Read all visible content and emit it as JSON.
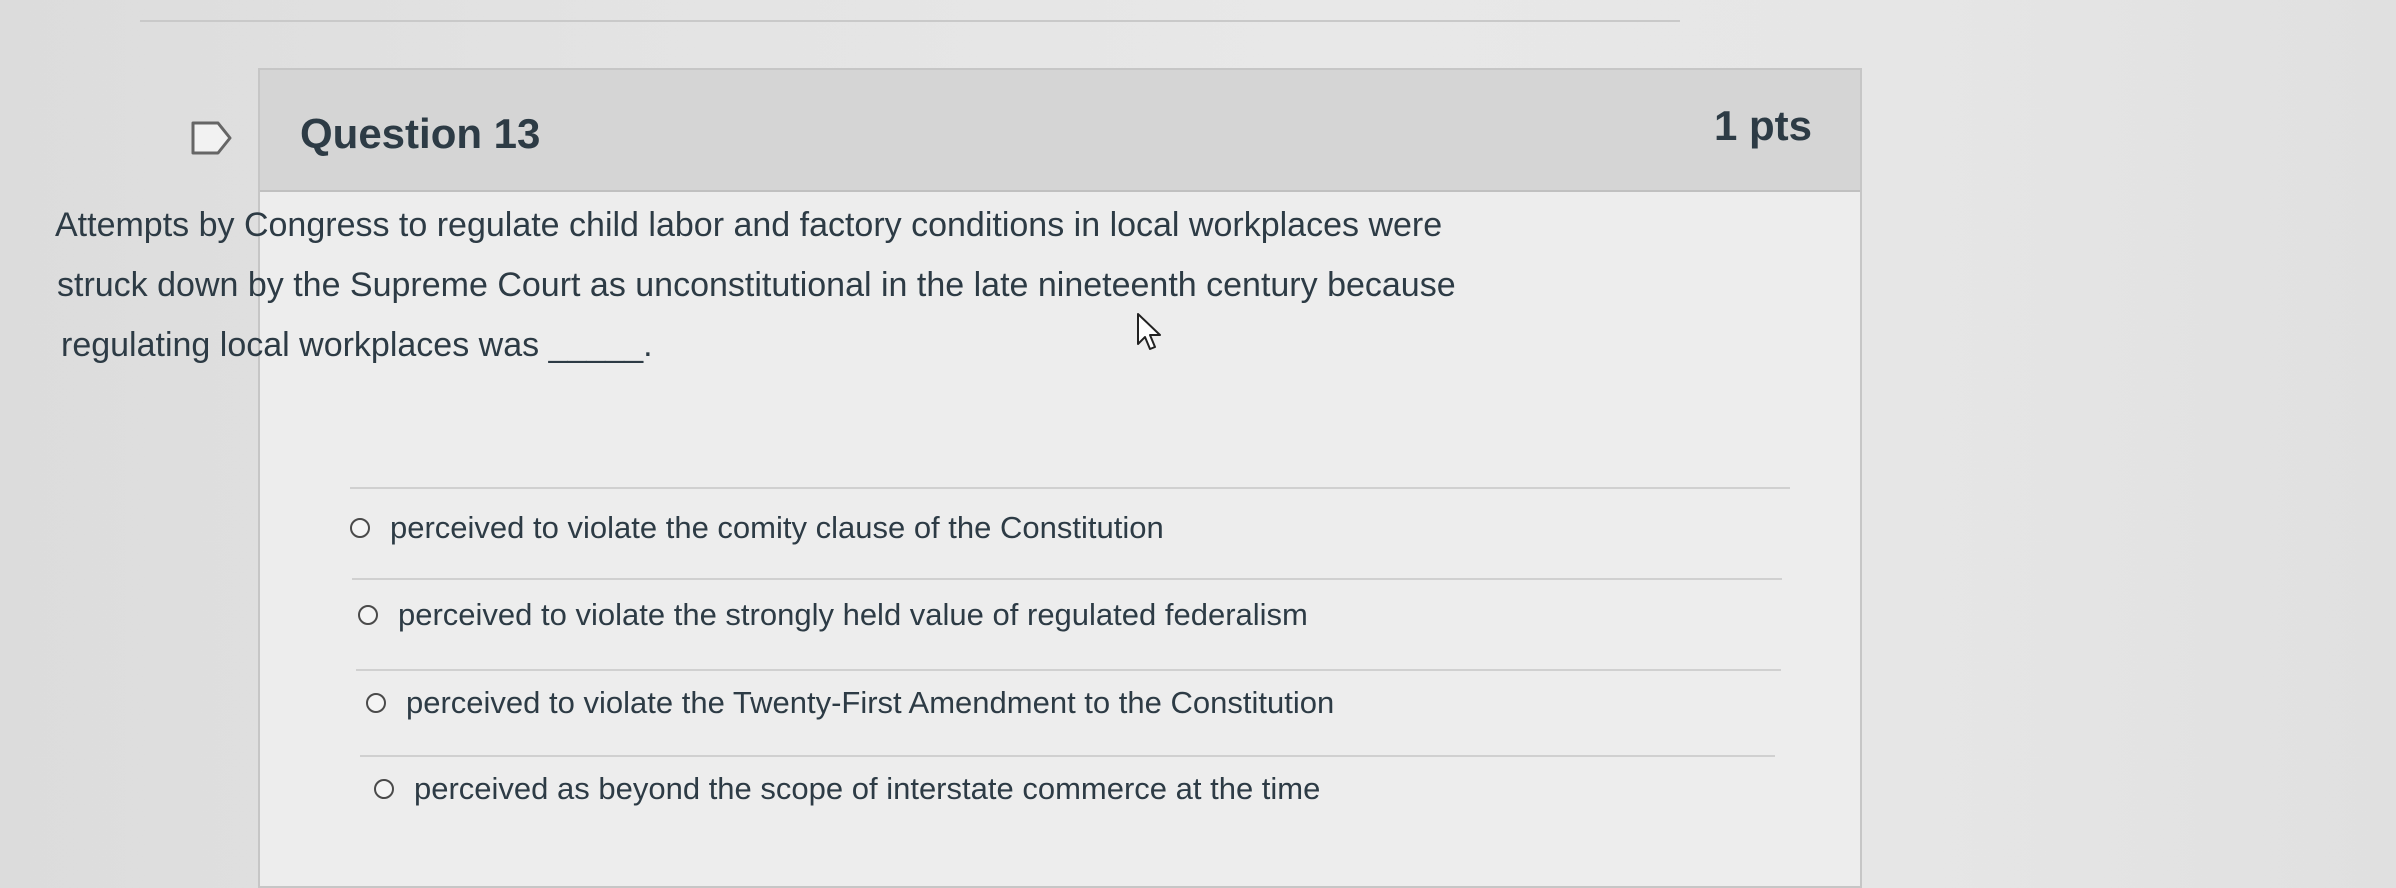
{
  "question": {
    "title": "Question 13",
    "points": "1 pts",
    "text_lines": [
      "Attempts by Congress to regulate child labor and factory conditions in local workplaces were",
      "struck down by the Supreme Court as unconstitutional in the late nineteenth century because",
      "regulating local workplaces was _____."
    ]
  },
  "answers": [
    {
      "label": "perceived to violate the comity clause of the Constitution",
      "selected": false
    },
    {
      "label": "perceived to violate the strongly held value of regulated federalism",
      "selected": false
    },
    {
      "label": "perceived to violate the Twenty-First Amendment to the Constitution",
      "selected": false
    },
    {
      "label": "perceived as beyond the scope of interstate commerce at the time",
      "selected": false
    }
  ],
  "icons": {
    "flag": "flag-question-icon",
    "cursor": "mouse-pointer-icon",
    "radio": "radio-unselected-icon"
  },
  "colors": {
    "text": "#2d3b45",
    "header_bg": "#d5d5d5",
    "card_bg": "#ededed",
    "page_bg": "#e4e4e4"
  }
}
